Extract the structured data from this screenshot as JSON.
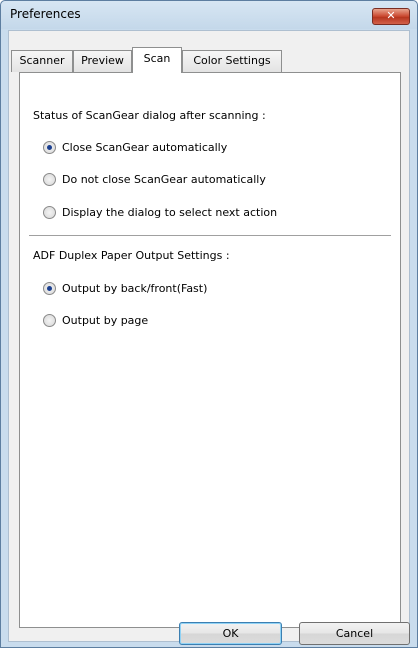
{
  "window": {
    "title": "Preferences",
    "close_glyph": "✕"
  },
  "tabs": [
    {
      "label": "Scanner",
      "active": false
    },
    {
      "label": "Preview",
      "active": false
    },
    {
      "label": "Scan",
      "active": true
    },
    {
      "label": "Color Settings",
      "active": false
    }
  ],
  "scan_tab": {
    "status_group": {
      "label": "Status of ScanGear dialog after scanning :",
      "options": [
        {
          "label": "Close ScanGear automatically",
          "selected": true
        },
        {
          "label": "Do not close ScanGear automatically",
          "selected": false
        },
        {
          "label": "Display the dialog to select next action",
          "selected": false
        }
      ]
    },
    "duplex_group": {
      "label": "ADF Duplex Paper Output Settings :",
      "options": [
        {
          "label": "Output by back/front(Fast)",
          "selected": true
        },
        {
          "label": "Output by page",
          "selected": false
        }
      ]
    }
  },
  "buttons": {
    "ok": "OK",
    "cancel": "Cancel"
  }
}
